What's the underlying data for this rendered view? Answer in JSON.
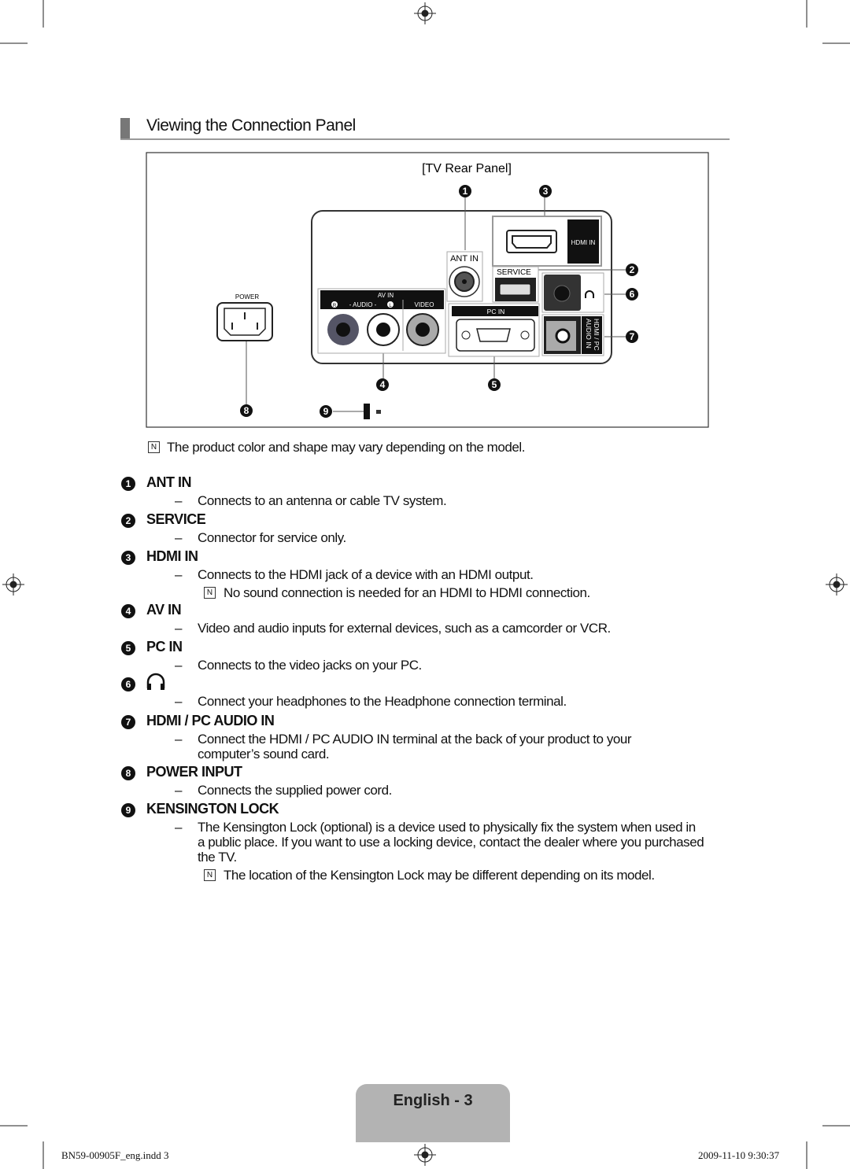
{
  "page_title": "Viewing the Connection Panel",
  "diagram": {
    "caption": "[TV Rear Panel]",
    "labels": {
      "ant_in": "ANT IN",
      "hdmi_in": "HDMI IN",
      "service": "SERVICE",
      "av_in": "AV IN",
      "audio_r": "R",
      "audio": "- AUDIO -",
      "audio_l": "L",
      "video": "VIDEO",
      "pc_in": "PC IN",
      "hdmi_pc_audio_line1": "HDMI / PC",
      "hdmi_pc_audio_line2": "AUDIO IN",
      "power": "POWER"
    },
    "callouts": [
      "1",
      "2",
      "3",
      "4",
      "5",
      "6",
      "7",
      "8",
      "9"
    ]
  },
  "note_main": "The product color and shape may vary depending on the model.",
  "items": [
    {
      "num": "1",
      "title": "ANT IN",
      "desc": [
        "Connects to an antenna or cable TV system."
      ]
    },
    {
      "num": "2",
      "title": "SERVICE",
      "desc": [
        "Connector for service only."
      ]
    },
    {
      "num": "3",
      "title": "HDMI IN",
      "desc": [
        "Connects to the HDMI jack of a device with an HDMI output."
      ],
      "note": "No sound connection is needed for an HDMI to HDMI connection."
    },
    {
      "num": "4",
      "title": "AV IN",
      "desc": [
        "Video and audio inputs for external devices, such as a camcorder or VCR."
      ]
    },
    {
      "num": "5",
      "title": "PC IN",
      "desc": [
        "Connects to the video jacks on your PC."
      ]
    },
    {
      "num": "6",
      "title": "",
      "icon": "headphones-icon",
      "desc": [
        "Connect your headphones to the Headphone connection terminal."
      ]
    },
    {
      "num": "7",
      "title": "HDMI / PC AUDIO IN",
      "desc": [
        "Connect the HDMI / PC AUDIO IN terminal at the back of your product to your",
        "computer’s sound card."
      ]
    },
    {
      "num": "8",
      "title": "POWER INPUT",
      "desc": [
        "Connects the supplied power cord."
      ]
    },
    {
      "num": "9",
      "title": "KENSINGTON LOCK",
      "desc": [
        "The Kensington Lock (optional) is a device used to physically fix the system when used in",
        "a public place. If you want to use a locking device, contact the dealer where you purchased",
        "the TV."
      ],
      "note": "The location of the Kensington Lock may be different depending on its model."
    }
  ],
  "dash": "–",
  "note_symbol": "N",
  "footer": {
    "page_label": "English - 3",
    "file": "BN59-00905F_eng.indd   3",
    "timestamp": "2009-11-10   9:30:37"
  }
}
